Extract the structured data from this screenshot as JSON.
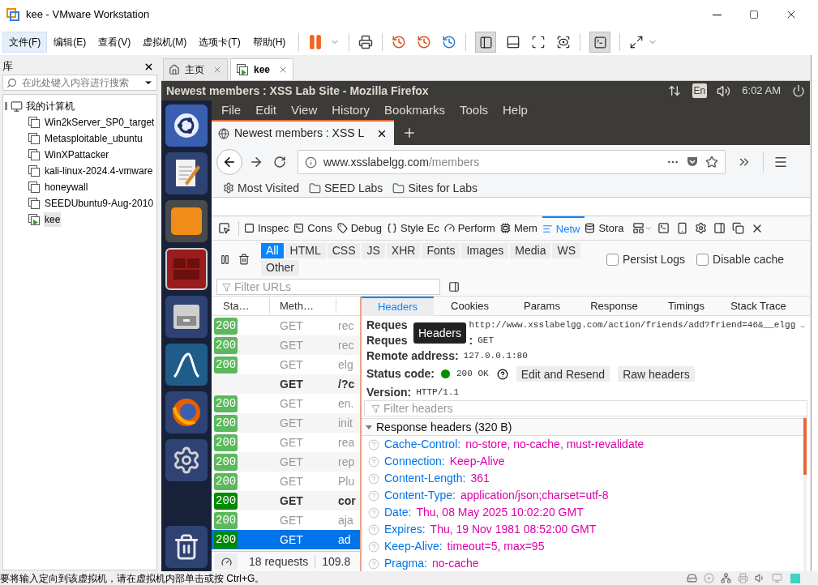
{
  "window": {
    "title": "kee - VMware Workstation"
  },
  "menu": [
    {
      "label": "文件(F)",
      "selected": true
    },
    {
      "label": "编辑(E)",
      "selected": false
    },
    {
      "label": "查看(V)",
      "selected": false
    },
    {
      "label": "虚拟机(M)",
      "selected": false
    },
    {
      "label": "选项卡(T)",
      "selected": false
    },
    {
      "label": "帮助(H)",
      "selected": false
    }
  ],
  "library": {
    "title": "库",
    "search": {
      "placeholder": "在此处键入内容进行搜索"
    },
    "tree": [
      {
        "label": "我的计算机",
        "expanded": true,
        "children": [
          {
            "label": "Win2kServer_SP0_target",
            "selected": false,
            "running": false
          },
          {
            "label": "Metasploitable_ubuntu",
            "selected": false,
            "running": false
          },
          {
            "label": "WinXPattacker",
            "selected": false,
            "running": false
          },
          {
            "label": "kali-linux-2024.4-vmware",
            "selected": false,
            "running": false
          },
          {
            "label": "honeywall",
            "selected": false,
            "running": false
          },
          {
            "label": "SEEDUbuntu9-Aug-2010",
            "selected": false,
            "running": false
          },
          {
            "label": "kee",
            "selected": true,
            "running": true
          }
        ]
      }
    ]
  },
  "vm_tabs": [
    {
      "label": "主页",
      "kind": "home",
      "selected": false
    },
    {
      "label": "kee",
      "kind": "vm",
      "selected": true
    }
  ],
  "ubuntu_bar": {
    "title": "Newest members : XSS Lab Site - Mozilla Firefox",
    "keyboard": "En",
    "time": "6:02 AM"
  },
  "firefox": {
    "menu": [
      "File",
      "Edit",
      "View",
      "History",
      "Bookmarks",
      "Tools",
      "Help"
    ],
    "tab": {
      "title": "Newest members : XSS L"
    },
    "url": {
      "domain": "www.xsslabelgg.com",
      "path": "/members"
    },
    "bookmarks": [
      {
        "label": "Most Visited",
        "kind": "gear"
      },
      {
        "label": "SEED Labs",
        "kind": "folder"
      },
      {
        "label": "Sites for Labs",
        "kind": "folder"
      }
    ]
  },
  "devtools": {
    "tabs": [
      {
        "label": "Inspec",
        "kind": "inspector",
        "selected": false
      },
      {
        "label": "Cons",
        "kind": "console",
        "selected": false
      },
      {
        "label": "Debug",
        "kind": "debugger",
        "selected": false
      },
      {
        "label": "Style Ec",
        "kind": "style",
        "selected": false
      },
      {
        "label": "Perform",
        "kind": "performance",
        "selected": false
      },
      {
        "label": "Mem",
        "kind": "memory",
        "selected": false
      },
      {
        "label": "Netw",
        "kind": "network",
        "selected": true
      },
      {
        "label": "Stora",
        "kind": "storage",
        "selected": false
      }
    ],
    "filters": [
      {
        "label": "All",
        "selected": true
      },
      {
        "label": "HTML",
        "selected": false
      },
      {
        "label": "CSS",
        "selected": false
      },
      {
        "label": "JS",
        "selected": false
      },
      {
        "label": "XHR",
        "selected": false
      },
      {
        "label": "Fonts",
        "selected": false
      },
      {
        "label": "Images",
        "selected": false
      },
      {
        "label": "Media",
        "selected": false
      },
      {
        "label": "WS",
        "selected": false
      },
      {
        "label": "Other",
        "selected": false
      }
    ],
    "options": [
      {
        "label": "Persist Logs",
        "checked": false
      },
      {
        "label": "Disable cache",
        "checked": false
      }
    ],
    "filter_urls": {
      "placeholder": "Filter URLs"
    },
    "table": {
      "columns": [
        "Sta…",
        "Meth…"
      ],
      "rows": [
        {
          "status": "200",
          "color": "#5cb85c",
          "method": "GET",
          "file": "rec",
          "bold": false,
          "selected": false
        },
        {
          "status": "200",
          "color": "#5cb85c",
          "method": "GET",
          "file": "rec",
          "bold": false,
          "selected": false
        },
        {
          "status": "200",
          "color": "#5cb85c",
          "method": "GET",
          "file": "elg",
          "bold": false,
          "selected": false
        },
        {
          "method": "GET",
          "file": "/?c",
          "bold": true,
          "selected": false
        },
        {
          "status": "200",
          "color": "#5cb85c",
          "method": "GET",
          "file": "en.",
          "bold": false,
          "selected": false
        },
        {
          "status": "200",
          "color": "#5cb85c",
          "method": "GET",
          "file": "init",
          "bold": false,
          "selected": false
        },
        {
          "status": "200",
          "color": "#5cb85c",
          "method": "GET",
          "file": "rea",
          "bold": false,
          "selected": false
        },
        {
          "status": "200",
          "color": "#5cb85c",
          "method": "GET",
          "file": "rep",
          "bold": false,
          "selected": false
        },
        {
          "status": "200",
          "color": "#5cb85c",
          "method": "GET",
          "file": "Plu",
          "bold": false,
          "selected": false
        },
        {
          "status": "200",
          "color": "#008a00",
          "method": "GET",
          "file": "cor",
          "bold": true,
          "selected": false
        },
        {
          "status": "200",
          "color": "#5cb85c",
          "method": "GET",
          "file": "aja",
          "bold": false,
          "selected": false
        },
        {
          "status": "200",
          "color": "#008a00",
          "method": "GET",
          "file": "ad",
          "bold": false,
          "selected": true
        }
      ]
    },
    "summary": {
      "requests": "18 requests",
      "size": "109.8"
    },
    "details": {
      "tabs": [
        {
          "label": "Headers",
          "selected": true
        },
        {
          "label": "Cookies",
          "selected": false
        },
        {
          "label": "Params",
          "selected": false
        },
        {
          "label": "Response",
          "selected": false
        },
        {
          "label": "Timings",
          "selected": false
        },
        {
          "label": "Stack Trace",
          "selected": false
        }
      ],
      "tooltip": "Headers",
      "request_url": {
        "label": "Reques",
        "value": "http://www.xsslabelgg.com/action/friends/add?friend=46&__elgg …"
      },
      "request_method": {
        "label": "Reques",
        "label_tail": ":",
        "value": "GET"
      },
      "remote_address": {
        "label": "Remote address:",
        "value": "127.0.0.1:80"
      },
      "status_code": {
        "label": "Status code:",
        "value": "200 OK"
      },
      "buttons": [
        "Edit and Resend",
        "Raw headers"
      ],
      "version": {
        "label": "Version:",
        "value": "HTTP/1.1"
      },
      "filter_headers": {
        "placeholder": "Filter headers"
      },
      "section": {
        "title": "Response headers (320 B)",
        "expanded": true
      },
      "headers": [
        {
          "name": "Cache-Control:",
          "value": "no-store, no-cache, must-revalidate"
        },
        {
          "name": "Connection:",
          "value": "Keep-Alive"
        },
        {
          "name": "Content-Length:",
          "value": "361"
        },
        {
          "name": "Content-Type:",
          "value": "application/json;charset=utf-8"
        },
        {
          "name": "Date:",
          "value": "Thu, 08 May 2025 10:02:20 GMT"
        },
        {
          "name": "Expires:",
          "value": "Thu, 19 Nov 1981 08:52:00 GMT"
        },
        {
          "name": "Keep-Alive:",
          "value": "timeout=5, max=95"
        },
        {
          "name": "Pragma:",
          "value": "no-cache"
        }
      ]
    }
  },
  "status_bar": {
    "message": "要将输入定向到该虚拟机，请在虚拟机内部单击或按 Ctrl+G。"
  }
}
